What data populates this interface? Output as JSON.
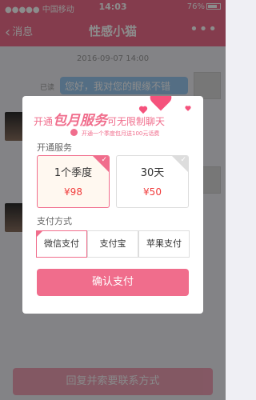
{
  "status_bar": {
    "carrier": "●●●●● 中国移动",
    "wifi_icon": "wifi-icon",
    "time": "14:03",
    "battery_text": "76%"
  },
  "nav": {
    "back_label": "消息",
    "title": "性感小猫",
    "more_icon": "more-dots-icon"
  },
  "chat": {
    "timestamp": "2016-09-07 14:00",
    "read_flag": "已读",
    "outgoing_message": "您好，我对您的眼缘不错"
  },
  "modal": {
    "banner_prefix": "开通",
    "banner_highlight": "包月服务",
    "banner_suffix": "可无限制聊天",
    "banner_sub": "开通一个季度包月送100元话费",
    "service_label": "开通服务",
    "packages": [
      {
        "name": "1个季度",
        "price": "¥98",
        "selected": true
      },
      {
        "name": "30天",
        "price": "¥50",
        "selected": false
      }
    ],
    "pay_label": "支付方式",
    "pay_methods": [
      {
        "label": "微信支付",
        "selected": true
      },
      {
        "label": "支付宝",
        "selected": false
      },
      {
        "label": "苹果支付",
        "selected": false
      }
    ],
    "confirm_label": "确认支付"
  },
  "bottom_button": "回复并索要联系方式",
  "colors": {
    "accent": "#f06d8c",
    "price_red": "#f03c3c"
  }
}
